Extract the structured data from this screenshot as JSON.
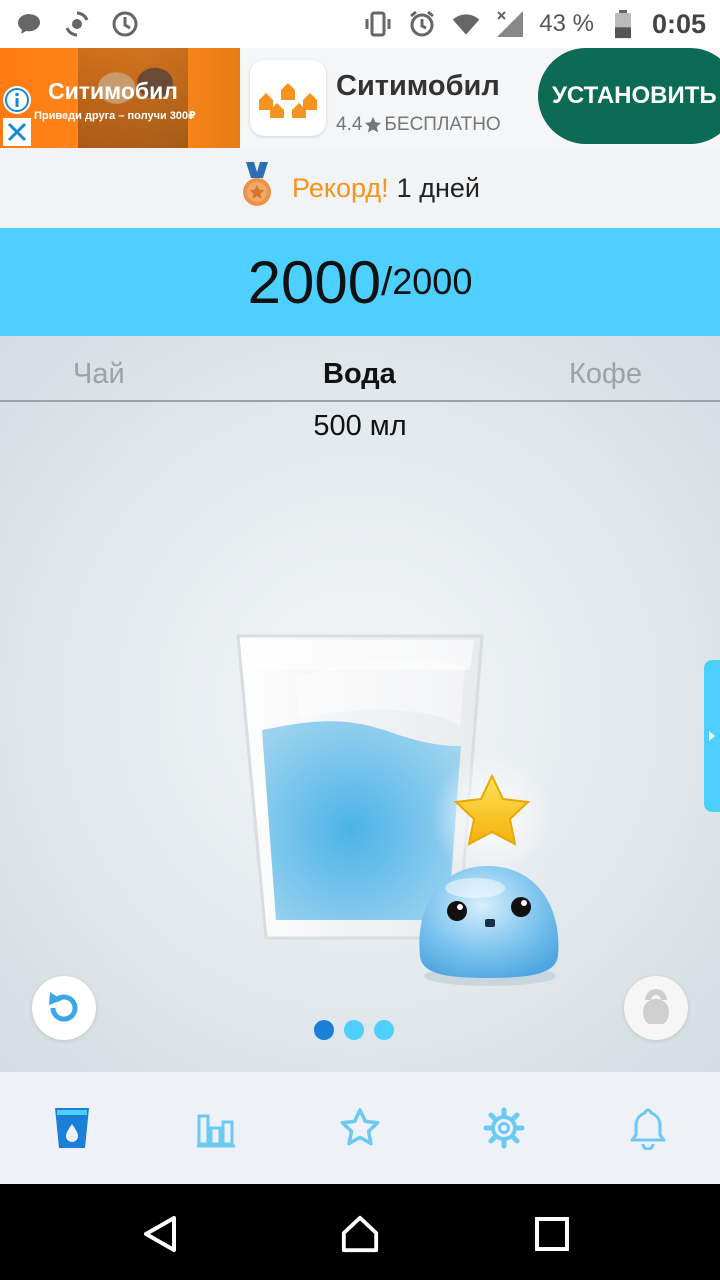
{
  "status_bar": {
    "battery_percent": "43 %",
    "time": "0:05",
    "battery_level": 0.43,
    "icons": [
      "message-icon",
      "sync-icon",
      "clock-icon",
      "vibrate-icon",
      "alarm-icon",
      "wifi-icon",
      "signal-icon",
      "battery-icon"
    ]
  },
  "ad": {
    "image_title": "Ситимобил",
    "image_subtitle": "Приведи друга – получи 300₽",
    "app_name": "Ситимобил",
    "rating": "4.4",
    "price": "БЕСПЛАТНО",
    "install_label": "УСТАНОВИТЬ"
  },
  "record": {
    "label": "Рекорд!",
    "value": "1 дней"
  },
  "progress": {
    "current": "2000",
    "slash": "/",
    "goal": "2000"
  },
  "tabs": [
    {
      "label": "Чай",
      "active": false
    },
    {
      "label": "Вода",
      "active": true
    },
    {
      "label": "Кофе",
      "active": false
    }
  ],
  "volume": "500 мл",
  "pager": {
    "count": 3,
    "active": 0
  },
  "bottom_nav": [
    "glass-icon",
    "stats-icon",
    "star-icon",
    "gear-icon",
    "bell-icon"
  ],
  "colors": {
    "accent": "#4dcfff",
    "active_nav": "#1a7fd6",
    "record": "#f5941f",
    "install": "#0b6b55"
  }
}
